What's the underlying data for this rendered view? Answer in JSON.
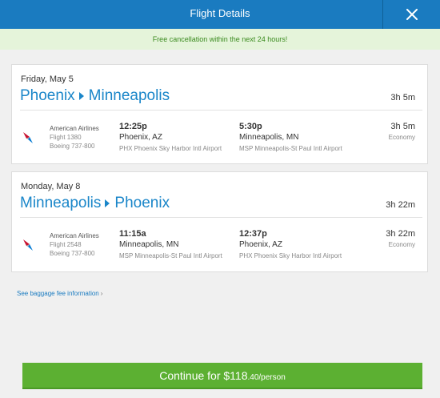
{
  "header": {
    "title": "Flight Details",
    "close_icon": "close-icon"
  },
  "notice": "Free cancellation within the next 24 hours!",
  "trips": [
    {
      "date": "Friday, May 5",
      "origin": "Phoenix",
      "destination": "Minneapolis",
      "duration": "3h 5m",
      "segment": {
        "airline": "American Airlines",
        "flight": "Flight 1380",
        "aircraft": "Boeing 737-800",
        "dep_time": "12:25p",
        "dep_city": "Phoenix, AZ",
        "dep_airport": "PHX Phoenix Sky Harbor Intl Airport",
        "arr_time": "5:30p",
        "arr_city": "Minneapolis, MN",
        "arr_airport": "MSP Minneapolis-St Paul Intl Airport",
        "duration": "3h 5m",
        "cabin": "Economy"
      }
    },
    {
      "date": "Monday, May 8",
      "origin": "Minneapolis",
      "destination": "Phoenix",
      "duration": "3h 22m",
      "segment": {
        "airline": "American Airlines",
        "flight": "Flight 2548",
        "aircraft": "Boeing 737-800",
        "dep_time": "11:15a",
        "dep_city": "Minneapolis, MN",
        "dep_airport": "MSP Minneapolis-St Paul Intl Airport",
        "arr_time": "12:37p",
        "arr_city": "Phoenix, AZ",
        "arr_airport": "PHX Phoenix Sky Harbor Intl Airport",
        "duration": "3h 22m",
        "cabin": "Economy"
      }
    }
  ],
  "baggage_link": "See baggage fee information",
  "continue": {
    "label_main": "Continue for $118",
    "label_cents": ".40/person"
  },
  "colors": {
    "header": "#1a7bc0",
    "accent": "#1a86c9",
    "notice_text": "#3a8a1e",
    "notice_bg": "#e5f4da",
    "cta": "#5cb032"
  }
}
